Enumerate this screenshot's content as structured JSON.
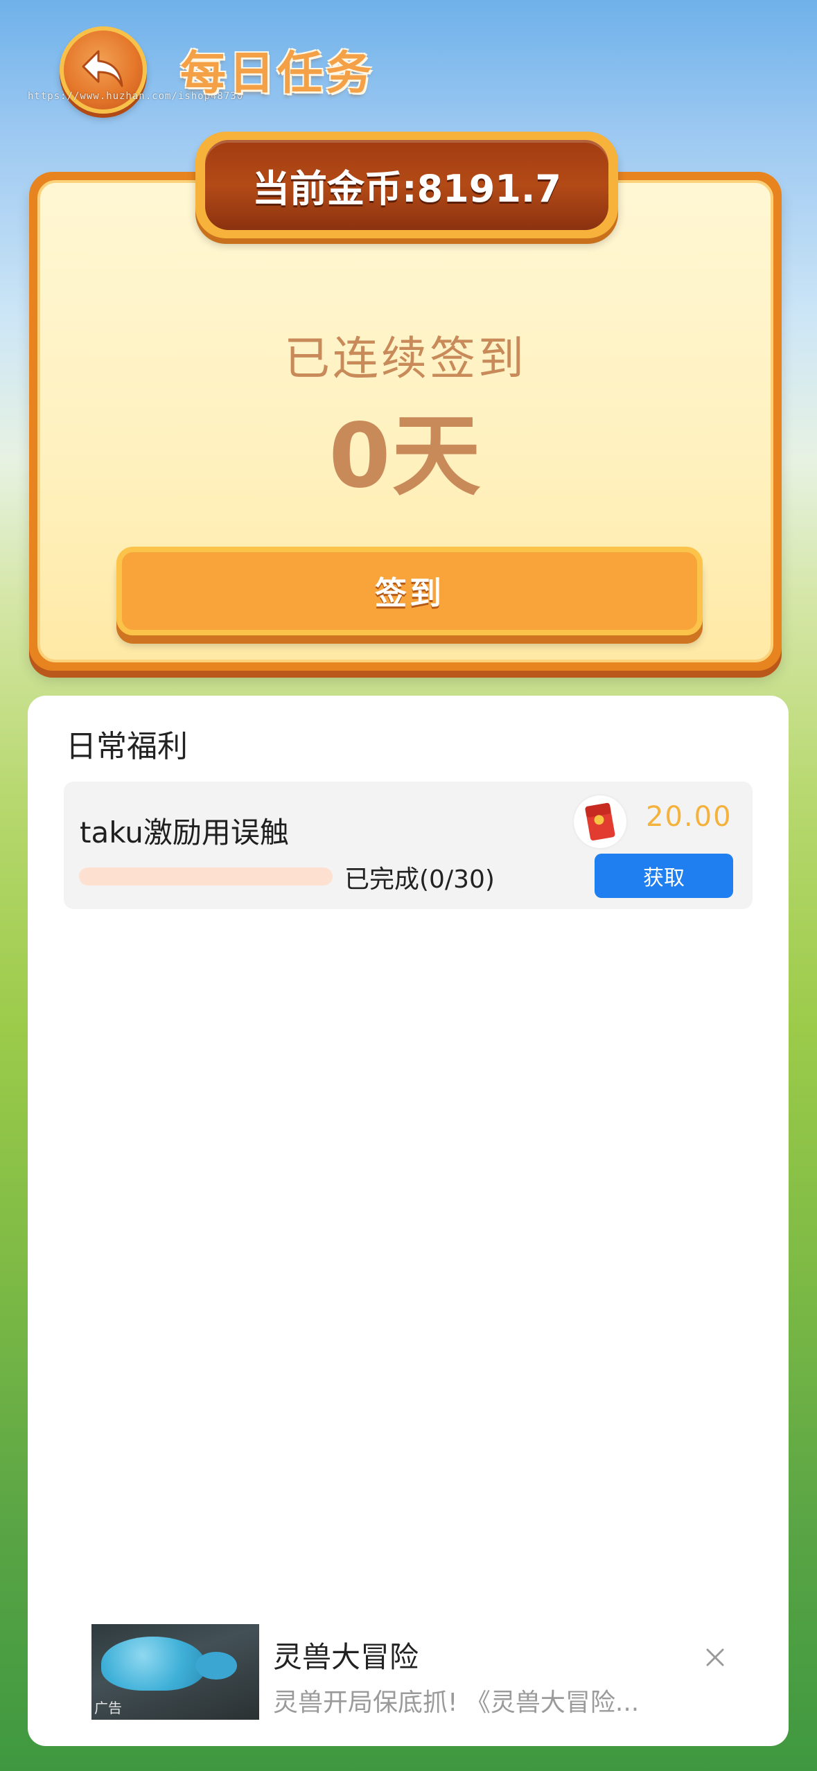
{
  "header": {
    "title": "每日任务",
    "watermark": "https://www.huzhan.com/ishop48730"
  },
  "signin": {
    "coins_text": "当前金币:8191.7",
    "streak_label": "已连续签到",
    "streak_value": "0天",
    "button_label": "签到"
  },
  "welfare": {
    "title": "日常福利",
    "tasks": [
      {
        "name": "taku激励用误触",
        "progress_text": "已完成(0/30)",
        "progress_fraction": 0,
        "reward": "20.00",
        "button_label": "获取",
        "reward_icon": "red-envelope-icon"
      }
    ]
  },
  "ad": {
    "title": "灵兽大冒险",
    "description": "灵兽开局保底抓! 《灵兽大冒险...",
    "badge": "广告",
    "close_icon": "close-icon"
  },
  "colors": {
    "accent_orange": "#e7841f",
    "claim_blue": "#1f7ef0",
    "reward_gold": "#f4b23c"
  }
}
